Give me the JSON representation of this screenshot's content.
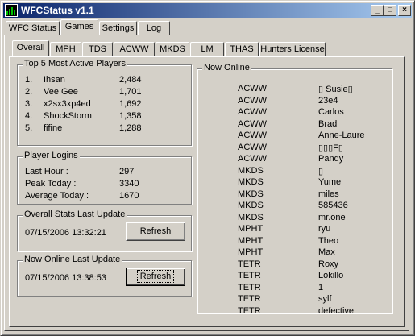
{
  "window": {
    "title": "WFCStatus v1.1"
  },
  "titlebar_buttons": {
    "minimize": "_",
    "maximize": "□",
    "close": "×"
  },
  "main_tabs": [
    "WFC Status",
    "Games",
    "Settings",
    "Log"
  ],
  "main_active_tab": "Games",
  "game_tabs": [
    "Overall",
    "MPH",
    "TDS",
    "ACWW",
    "MKDS",
    "LM",
    "THAS",
    "Hunters License"
  ],
  "game_active_tab": "Overall",
  "top5": {
    "title": "Top 5 Most Active Players",
    "rows": [
      {
        "rank": "1.",
        "name": "Ihsan",
        "count": "2,484"
      },
      {
        "rank": "2.",
        "name": "Vee Gee",
        "count": "1,701"
      },
      {
        "rank": "3.",
        "name": "x2sx3xp4ed",
        "count": "1,692"
      },
      {
        "rank": "4.",
        "name": "ShockStorm",
        "count": "1,358"
      },
      {
        "rank": "5.",
        "name": "fifine",
        "count": "1,288"
      }
    ]
  },
  "logins": {
    "title": "Player Logins",
    "rows": [
      {
        "label": "Last Hour :",
        "value": "297"
      },
      {
        "label": "Peak Today :",
        "value": "3340"
      },
      {
        "label": "Average Today :",
        "value": "1670"
      }
    ]
  },
  "overall_update": {
    "title": "Overall Stats Last Update",
    "timestamp": "07/15/2006 13:32:21",
    "button": "Refresh"
  },
  "online_update": {
    "title": "Now Online Last Update",
    "timestamp": "07/15/2006 13:38:53",
    "button": "Refresh"
  },
  "now_online": {
    "title": "Now Online",
    "rows": [
      {
        "game": "ACWW",
        "name": "▯ Susie▯"
      },
      {
        "game": "ACWW",
        "name": "23e4"
      },
      {
        "game": "ACWW",
        "name": "Carlos"
      },
      {
        "game": "ACWW",
        "name": "Brad"
      },
      {
        "game": "ACWW",
        "name": "Anne-Laure"
      },
      {
        "game": "ACWW",
        "name": "▯▯▯F▯"
      },
      {
        "game": "ACWW",
        "name": "Pandy"
      },
      {
        "game": "MKDS",
        "name": "▯"
      },
      {
        "game": "MKDS",
        "name": "Yume"
      },
      {
        "game": "MKDS",
        "name": "miles"
      },
      {
        "game": "MKDS",
        "name": "585436"
      },
      {
        "game": "MKDS",
        "name": "mr.one"
      },
      {
        "game": "MPHT",
        "name": "ryu"
      },
      {
        "game": "MPHT",
        "name": "Theo"
      },
      {
        "game": "MPHT",
        "name": "Max"
      },
      {
        "game": "TETR",
        "name": "Roxy"
      },
      {
        "game": "TETR",
        "name": "Lokillo"
      },
      {
        "game": "TETR",
        "name": "1"
      },
      {
        "game": "TETR",
        "name": "sylf"
      },
      {
        "game": "TETR",
        "name": "defective"
      }
    ]
  }
}
